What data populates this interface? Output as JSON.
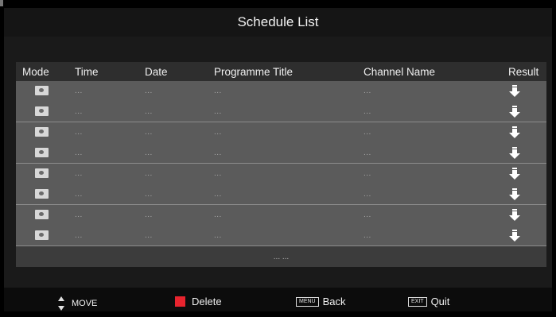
{
  "title": "Schedule List",
  "columns": {
    "mode": "Mode",
    "time": "Time",
    "date": "Date",
    "programme_title": "Programme Title",
    "channel_name": "Channel Name",
    "result": "Result"
  },
  "rows": [
    {
      "time": "...",
      "date": "...",
      "programme": "...",
      "channel": "...",
      "mode_icon": "alarm-clock-icon",
      "result_icon": "download-arrow-icon"
    },
    {
      "time": "...",
      "date": "...",
      "programme": "...",
      "channel": "...",
      "mode_icon": "alarm-clock-icon",
      "result_icon": "download-arrow-icon"
    },
    {
      "time": "...",
      "date": "...",
      "programme": "...",
      "channel": "...",
      "mode_icon": "alarm-clock-icon",
      "result_icon": "download-arrow-icon"
    },
    {
      "time": "...",
      "date": "...",
      "programme": "...",
      "channel": "...",
      "mode_icon": "alarm-clock-icon",
      "result_icon": "download-arrow-icon"
    },
    {
      "time": "...",
      "date": "...",
      "programme": "...",
      "channel": "...",
      "mode_icon": "alarm-clock-icon",
      "result_icon": "download-arrow-icon"
    },
    {
      "time": "...",
      "date": "...",
      "programme": "...",
      "channel": "...",
      "mode_icon": "alarm-clock-icon",
      "result_icon": "download-arrow-icon"
    },
    {
      "time": "...",
      "date": "...",
      "programme": "...",
      "channel": "...",
      "mode_icon": "alarm-clock-icon",
      "result_icon": "download-arrow-icon"
    },
    {
      "time": "...",
      "date": "...",
      "programme": "...",
      "channel": "...",
      "mode_icon": "alarm-clock-icon",
      "result_icon": "download-arrow-icon"
    }
  ],
  "footer_text": "... ...",
  "hints": {
    "move": "MOVE",
    "delete": "Delete",
    "back_key": "MENU",
    "back": "Back",
    "quit_key": "EXIT",
    "quit": "Quit"
  },
  "colors": {
    "background": "#000000",
    "panel": "#1a1a1a",
    "row_group": "#5b5b5b",
    "delete_accent": "#e8242e"
  }
}
